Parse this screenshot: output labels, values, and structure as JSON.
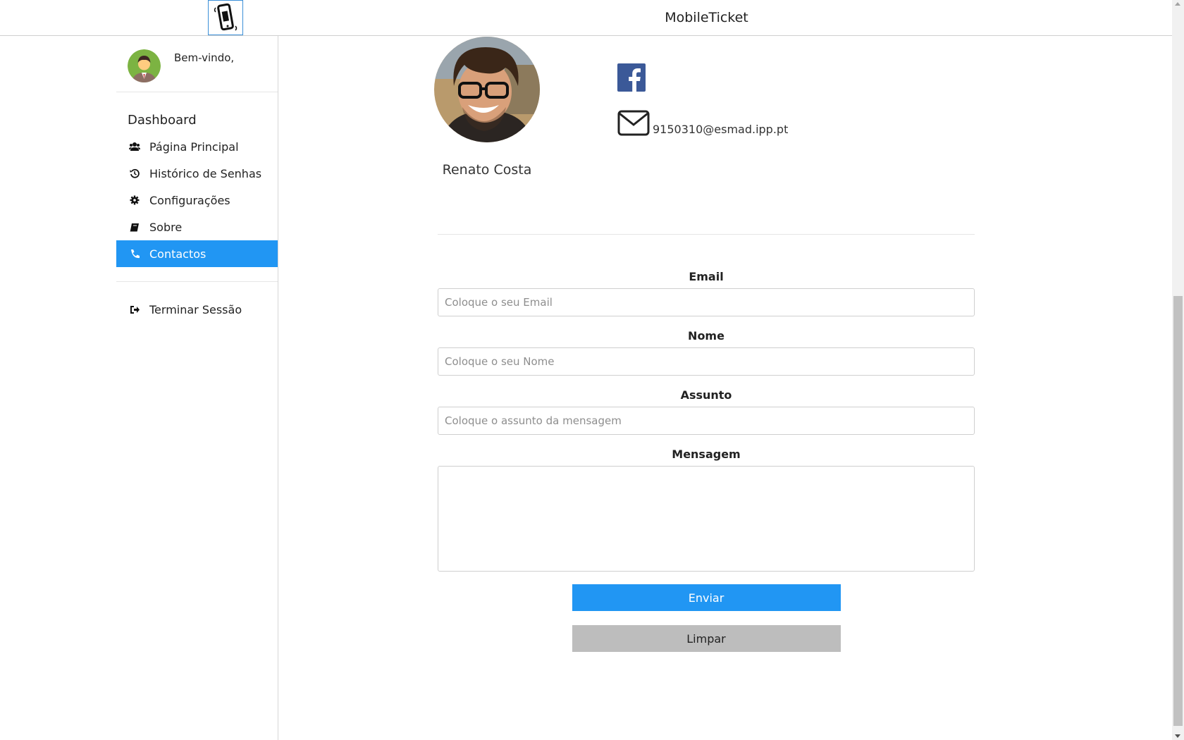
{
  "header": {
    "title": "MobileTicket",
    "logo_icon": "mobile-phone-icon"
  },
  "sidebar": {
    "welcome": "Bem-vindo,",
    "section_title": "Dashboard",
    "items": [
      {
        "label": "Página Principal",
        "icon": "users-icon",
        "active": false
      },
      {
        "label": "Histórico de Senhas",
        "icon": "history-icon",
        "active": false
      },
      {
        "label": "Configurações",
        "icon": "gear-icon",
        "active": false
      },
      {
        "label": "Sobre",
        "icon": "book-icon",
        "active": false
      },
      {
        "label": "Contactos",
        "icon": "phone-icon",
        "active": true
      }
    ],
    "logout": {
      "label": "Terminar Sessão",
      "icon": "sign-out-icon"
    }
  },
  "profile": {
    "name": "Renato Costa",
    "email": "9150310@esmad.ipp.pt",
    "social_icon": "facebook-icon",
    "mail_icon": "envelope-icon"
  },
  "form": {
    "email": {
      "label": "Email",
      "placeholder": "Coloque o seu Email",
      "value": ""
    },
    "name": {
      "label": "Nome",
      "placeholder": "Coloque o seu Nome",
      "value": ""
    },
    "subject": {
      "label": "Assunto",
      "placeholder": "Coloque o assunto da mensagem",
      "value": ""
    },
    "message": {
      "label": "Mensagem",
      "placeholder": "",
      "value": ""
    },
    "send_label": "Enviar",
    "clear_label": "Limpar"
  },
  "colors": {
    "accent": "#2196f3",
    "clear_button": "#bdbdbd",
    "facebook": "#3b5998"
  }
}
